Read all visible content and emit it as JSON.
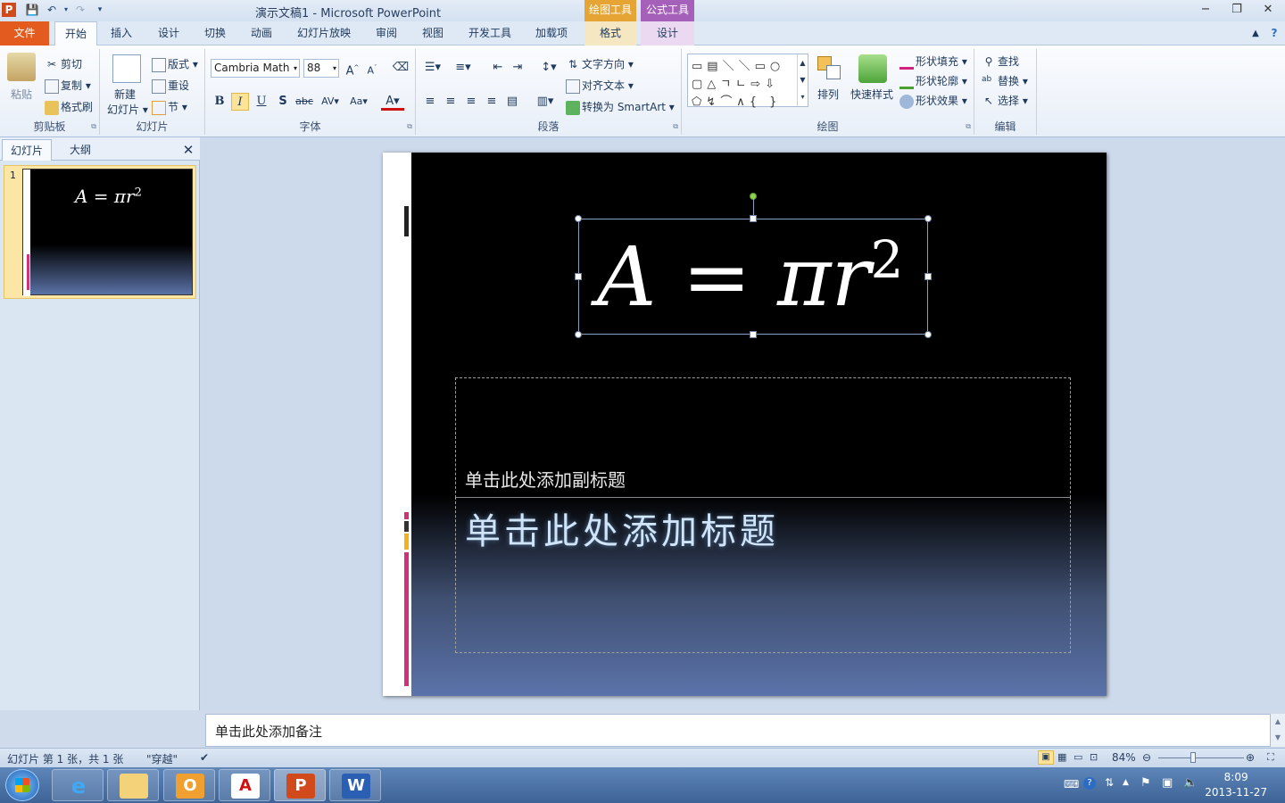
{
  "window": {
    "title": "演示文稿1 - Microsoft PowerPoint",
    "context_groups": [
      "绘图工具",
      "公式工具"
    ]
  },
  "tabs": [
    "文件",
    "开始",
    "插入",
    "设计",
    "切换",
    "动画",
    "幻灯片放映",
    "审阅",
    "视图",
    "开发工具",
    "加载项",
    "格式",
    "设计"
  ],
  "ribbon": {
    "clipboard": {
      "paste": "粘贴",
      "cut": "剪切",
      "copy": "复制",
      "format_painter": "格式刷",
      "label": "剪贴板"
    },
    "slides": {
      "new_slide_line1": "新建",
      "new_slide_line2": "幻灯片",
      "layout": "版式",
      "reset": "重设",
      "section": "节",
      "label": "幻灯片"
    },
    "font": {
      "name": "Cambria Math",
      "size": "88",
      "label": "字体"
    },
    "paragraph": {
      "text_direction": "文字方向",
      "align_text": "对齐文本",
      "smartart": "转换为 SmartArt",
      "label": "段落"
    },
    "drawing": {
      "arrange": "排列",
      "quick_styles": "快速样式",
      "shape_fill": "形状填充",
      "shape_outline": "形状轮廓",
      "shape_effects": "形状效果",
      "label": "绘图"
    },
    "editing": {
      "find": "查找",
      "replace": "替换",
      "select": "选择",
      "label": "编辑"
    }
  },
  "left_pane": {
    "tabs": [
      "幻灯片",
      "大纲"
    ],
    "slide_number": "1",
    "thumb_equation": "A = πr",
    "thumb_sup": "2"
  },
  "slide": {
    "equation": "A = πr",
    "equation_sup": "2",
    "subtitle_placeholder": "单击此处添加副标题",
    "title_placeholder": "单击此处添加标题"
  },
  "notes": {
    "placeholder": "单击此处添加备注"
  },
  "status": {
    "slide_info": "幻灯片 第 1 张，共 1 张",
    "theme": "\"穿越\"",
    "zoom": "84%"
  },
  "taskbar": {
    "time": "8:09",
    "date": "2013-11-27"
  },
  "colors": {
    "file_tab": "#e35b1e",
    "accent_magenta": "#d1307a",
    "accent_yellow": "#f2b318",
    "ribbon_bg": "#fbfcfe"
  }
}
